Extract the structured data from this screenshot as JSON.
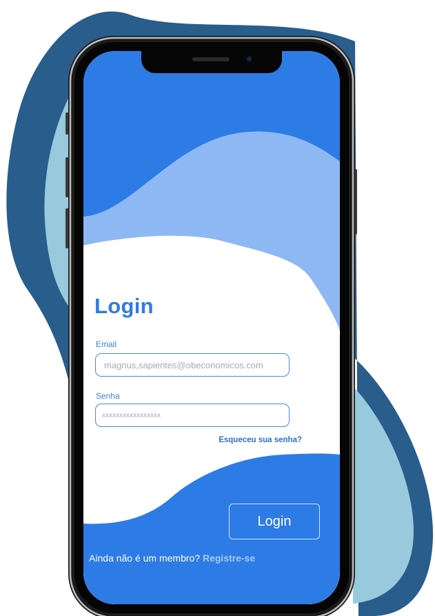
{
  "login": {
    "title": "Login",
    "email_label": "Email",
    "email_placeholder": "magnus,sapientes@obeconomicos.com",
    "password_label": "Senha",
    "password_placeholder": "xxxxxxxxxxxxxxxxx",
    "forgot_password": "Esqueceu sua senha?",
    "submit_label": "Login",
    "signup_prompt": "Ainda não é um membro?",
    "signup_link": "Registre-se"
  },
  "colors": {
    "primary_blue": "#2d7be5",
    "light_blue_wave": "#8db8f3",
    "backdrop_dark": "#285d8c",
    "backdrop_light": "#98c9dd"
  },
  "icons": {
    "front_camera": "camera-icon",
    "earpiece": "speaker-icon"
  }
}
